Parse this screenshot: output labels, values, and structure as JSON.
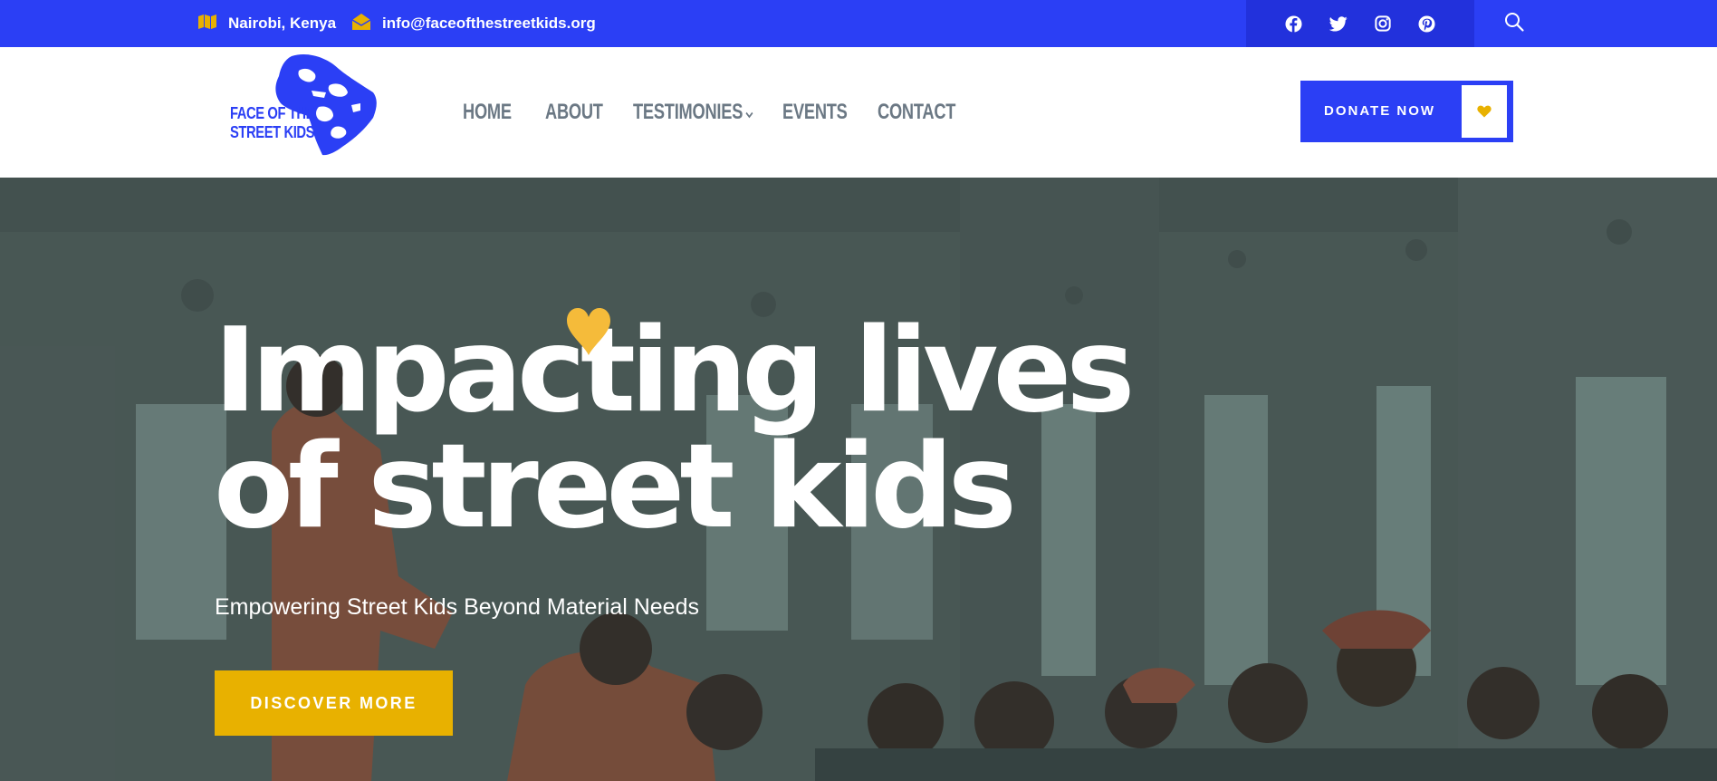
{
  "topbar": {
    "location": "Nairobi, Kenya",
    "location_icon": "map-icon",
    "email": "info@faceofthestreetkids.org",
    "email_icon": "envelope-open-icon",
    "social": [
      "facebook-icon",
      "twitter-icon",
      "instagram-icon",
      "pinterest-icon"
    ],
    "search_icon": "search-icon"
  },
  "header": {
    "logo": {
      "line1": "FACE OF THE",
      "line2": "STREET KIDS"
    },
    "nav": [
      {
        "label": "HOME"
      },
      {
        "label": "ABOUT"
      },
      {
        "label": "TESTIMONIES",
        "has_dropdown": true
      },
      {
        "label": "EVENTS"
      },
      {
        "label": "CONTACT"
      }
    ],
    "donate_label": "DONATE NOW",
    "donate_icon": "heart-icon"
  },
  "hero": {
    "headline_line1": "Impacting lives",
    "headline_line2": "of street kids",
    "subtitle": "Empowering Street Kids Beyond Material Needs",
    "cta_label": "DISCOVER MORE"
  },
  "colors": {
    "brand_blue": "#2b3ff5",
    "social_box_blue": "#2231dc",
    "accent_yellow": "#e8b100",
    "heart_yellow": "#f5bb3a",
    "nav_gray": "#6b7884"
  }
}
